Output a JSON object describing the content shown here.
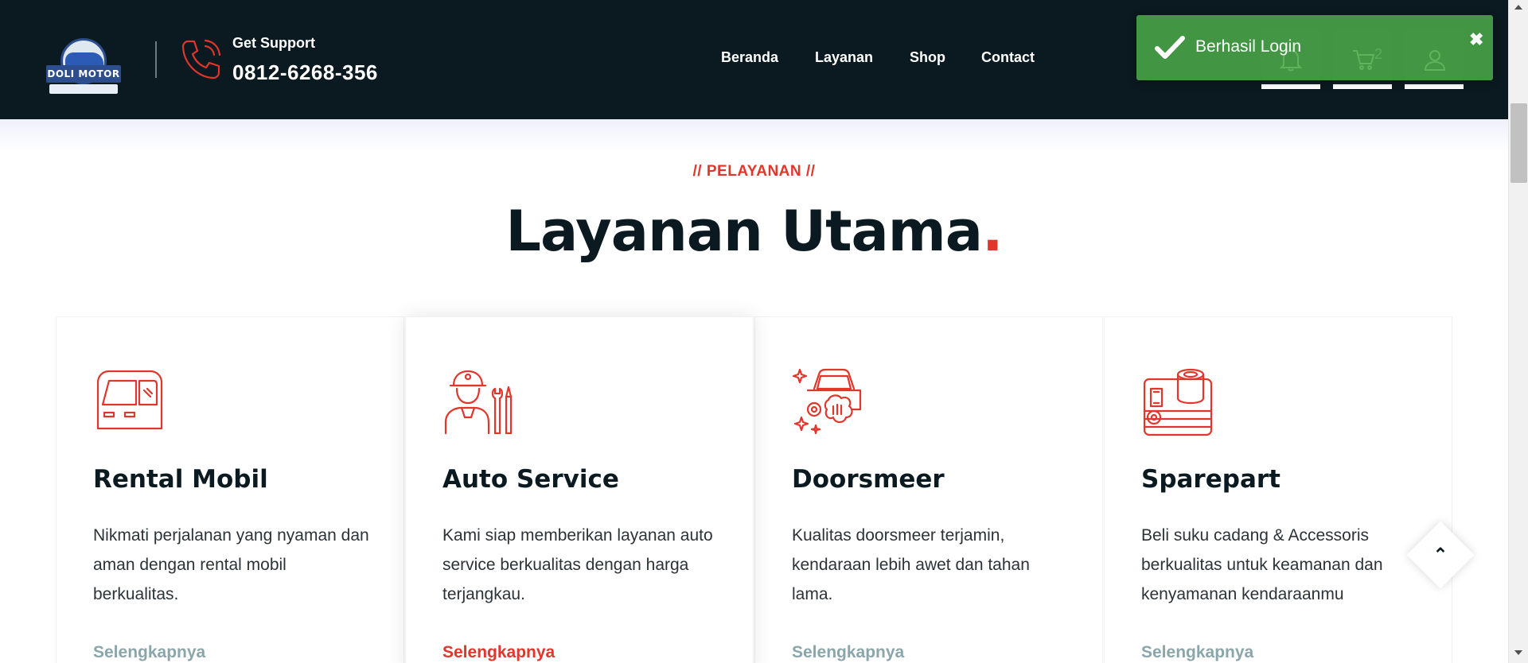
{
  "header": {
    "logo_text": "DOLI MOTOR",
    "support_label": "Get Support",
    "support_phone": "0812-6268-356",
    "nav": [
      {
        "label": "Beranda"
      },
      {
        "label": "Layanan"
      },
      {
        "label": "Shop"
      },
      {
        "label": "Contact"
      }
    ],
    "icons": {
      "notification": "bell-icon",
      "cart": "cart-icon",
      "account": "user-icon"
    },
    "cart_count": "2"
  },
  "toast": {
    "message": "Berhasil Login",
    "icon": "check-icon",
    "close_glyph": "✖"
  },
  "section": {
    "eyebrow": "// PELAYANAN //",
    "title": "Layanan Utama",
    "title_dot": "."
  },
  "services": [
    {
      "title": "Rental Mobil",
      "description": "Nikmati perjalanan yang nyaman dan aman dengan rental mobil berkualitas.",
      "link": "Selengkapnya",
      "icon": "car-door-icon"
    },
    {
      "title": "Auto Service",
      "description": "Kami siap memberikan layanan auto service berkualitas dengan harga terjangkau.",
      "link": "Selengkapnya",
      "icon": "mechanic-icon"
    },
    {
      "title": "Doorsmeer",
      "description": "Kualitas doorsmeer terjamin, kendaraan lebih awet dan tahan lama.",
      "link": "Selengkapnya",
      "icon": "car-wash-icon"
    },
    {
      "title": "Sparepart",
      "description": "Beli suku cadang & Accessoris berkualitas untuk keamanan dan kenyamanan kendaraanmu",
      "link": "Selengkapnya",
      "icon": "sparepart-icon"
    }
  ],
  "back_to_top": "⌃",
  "colors": {
    "header_bg": "#0b1a20",
    "accent": "#e0362c",
    "toast_bg": "#4caa48",
    "link_muted": "#8aa6ab"
  }
}
